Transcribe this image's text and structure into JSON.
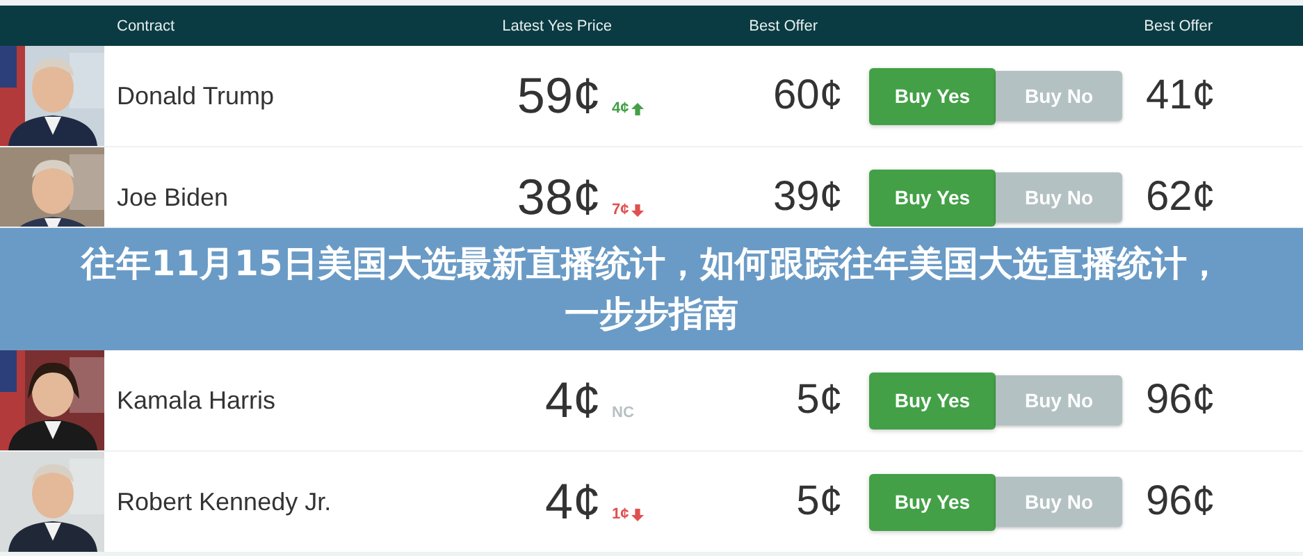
{
  "table": {
    "columns": [
      {
        "label": "Contract"
      },
      {
        "label": "Latest Yes Price"
      },
      {
        "label": "Best Offer"
      },
      {
        "label": "Best Offer"
      }
    ],
    "rows": [
      {
        "name": "Donald Trump",
        "price": "59¢",
        "change": {
          "text": "4¢",
          "kind": "up"
        },
        "best_yes": "60¢",
        "buy_yes": "Buy Yes",
        "buy_no": "Buy No",
        "best_no": "41¢"
      },
      {
        "name": "Joe Biden",
        "price": "38¢",
        "change": {
          "text": "7¢",
          "kind": "down"
        },
        "best_yes": "39¢",
        "buy_yes": "Buy Yes",
        "buy_no": "Buy No",
        "best_no": "62¢"
      },
      {
        "name": "Kamala Harris",
        "price": "4¢",
        "change": {
          "text": "NC",
          "kind": "none"
        },
        "best_yes": "5¢",
        "buy_yes": "Buy Yes",
        "buy_no": "Buy No",
        "best_no": "96¢"
      },
      {
        "name": "Robert Kennedy Jr.",
        "price": "4¢",
        "change": {
          "text": "1¢",
          "kind": "down"
        },
        "best_yes": "5¢",
        "buy_yes": "Buy Yes",
        "buy_no": "Buy No",
        "best_no": "96¢"
      }
    ]
  },
  "banner": {
    "title": "往年11月15日美国大选最新直播统计，如何跟踪往年美国大选直播统计，一步步指南"
  }
}
